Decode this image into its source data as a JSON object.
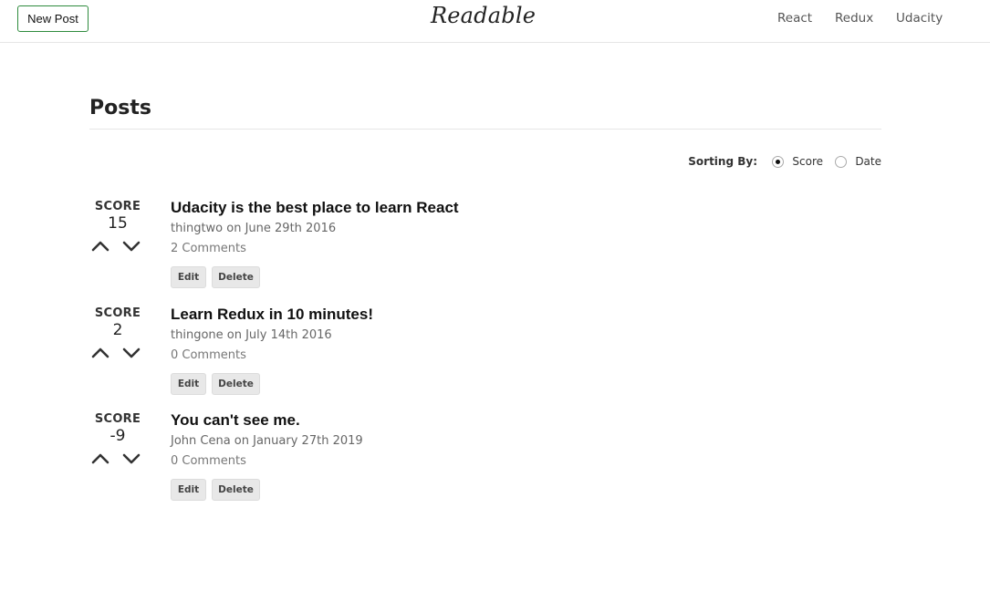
{
  "header": {
    "new_post_label": "New Post",
    "brand": "Readable",
    "nav": [
      "React",
      "Redux",
      "Udacity"
    ],
    "border_color": "#2e8b3d"
  },
  "main": {
    "title": "Posts",
    "sorting": {
      "label": "Sorting By:",
      "options": [
        "Score",
        "Date"
      ],
      "selected": "Score"
    },
    "posts": [
      {
        "score_label": "SCORE",
        "score": "15",
        "title": "Udacity is the best place to learn React",
        "meta": "thingtwo on June 29th 2016",
        "comments": "2 Comments",
        "edit": "Edit",
        "delete": "Delete"
      },
      {
        "score_label": "SCORE",
        "score": "2",
        "title": "Learn Redux in 10 minutes!",
        "meta": "thingone on July 14th 2016",
        "comments": "0 Comments",
        "edit": "Edit",
        "delete": "Delete"
      },
      {
        "score_label": "SCORE",
        "score": "-9",
        "title": "You can't see me.",
        "meta": "John Cena on January 27th 2019",
        "comments": "0 Comments",
        "edit": "Edit",
        "delete": "Delete"
      }
    ]
  }
}
